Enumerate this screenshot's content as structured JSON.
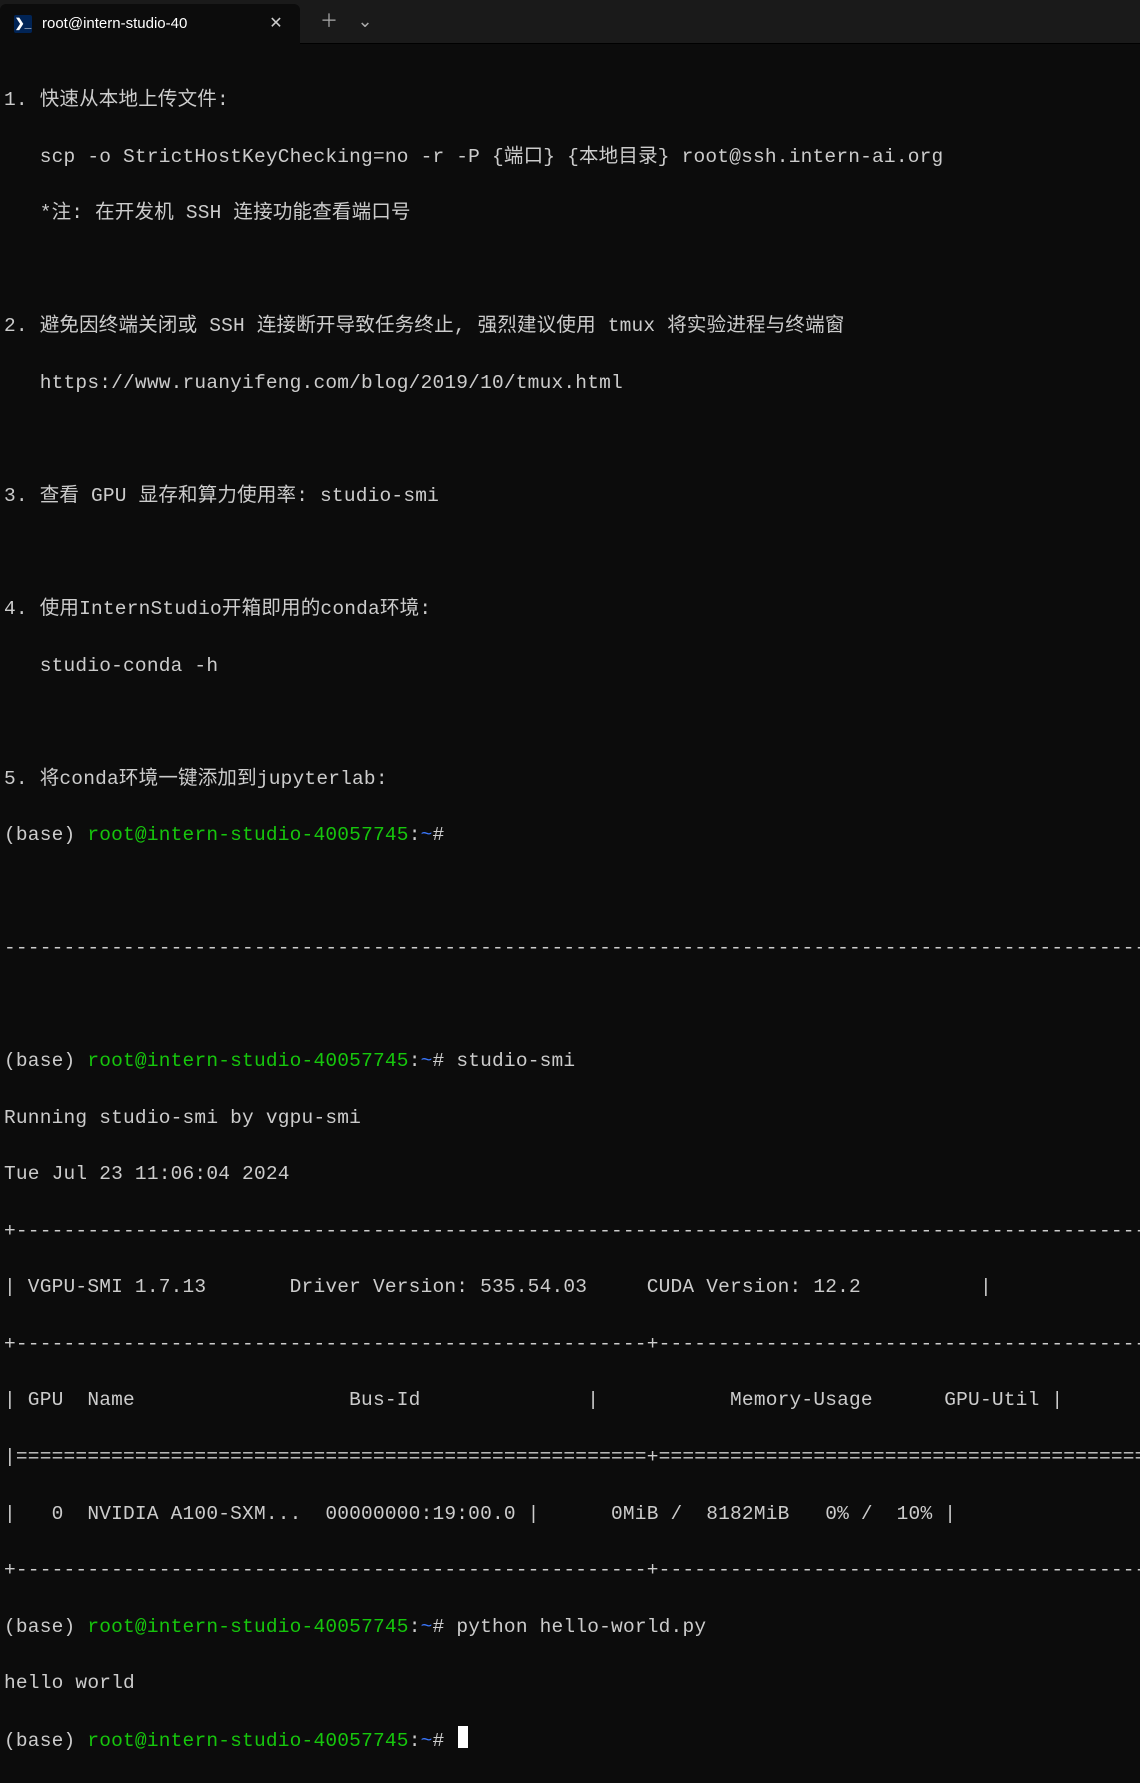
{
  "titlebar": {
    "tab_title": "root@intern-studio-40",
    "ps_glyph": "❯_",
    "close_glyph": "✕",
    "plus_glyph": "＋",
    "chevron_glyph": "⌄"
  },
  "prompt": {
    "env": "(base)",
    "user_host": "root@intern-studio-40057745",
    "sep": ":",
    "path": "~",
    "symbol": "#"
  },
  "motd": {
    "item1_head": "1. 快速从本地上传文件:",
    "item1_cmd": "   scp -o StrictHostKeyChecking=no -r -P {端口} {本地目录} root@ssh.intern-ai.org",
    "item1_note": "   *注: 在开发机 SSH 连接功能查看端口号",
    "item2_head": "2. 避免因终端关闭或 SSH 连接断开导致任务终止, 强烈建议使用 tmux 将实验进程与终端窗",
    "item2_link": "   https://www.ruanyifeng.com/blog/2019/10/tmux.html",
    "item3_head": "3. 查看 GPU 显存和算力使用率: studio-smi",
    "item4_head": "4. 使用InternStudio开箱即用的conda环境:",
    "item4_cmd": "   studio-conda -h",
    "item5_head": "5. 将conda环境一键添加到jupyterlab:"
  },
  "hr": "-------------------------------------------------------------------------------------------------------------",
  "cmds": {
    "studio_smi": "studio-smi",
    "python": "python hello-world.py"
  },
  "smi": {
    "running": "Running studio-smi by vgpu-smi",
    "date": "Tue Jul 23 11:06:04 2024",
    "border": "+---------------------------------------------------------------------------------------------------+",
    "header": "| VGPU-SMI 1.7.13       Driver Version: 535.54.03     CUDA Version: 12.2          |",
    "mid1": "+-----------------------------------------------------+---------------------------------------------+",
    "cols": "| GPU  Name                  Bus-Id              |           Memory-Usage      GPU-Util |",
    "mid2": "|=====================================================+=============================================|",
    "row": "|   0  NVIDIA A100-SXM...  00000000:19:00.0 |      0MiB /  8182MiB   0% /  10% |",
    "bottom": "+-----------------------------------------------------+---------------------------------------------+"
  },
  "hello_output": "hello world"
}
